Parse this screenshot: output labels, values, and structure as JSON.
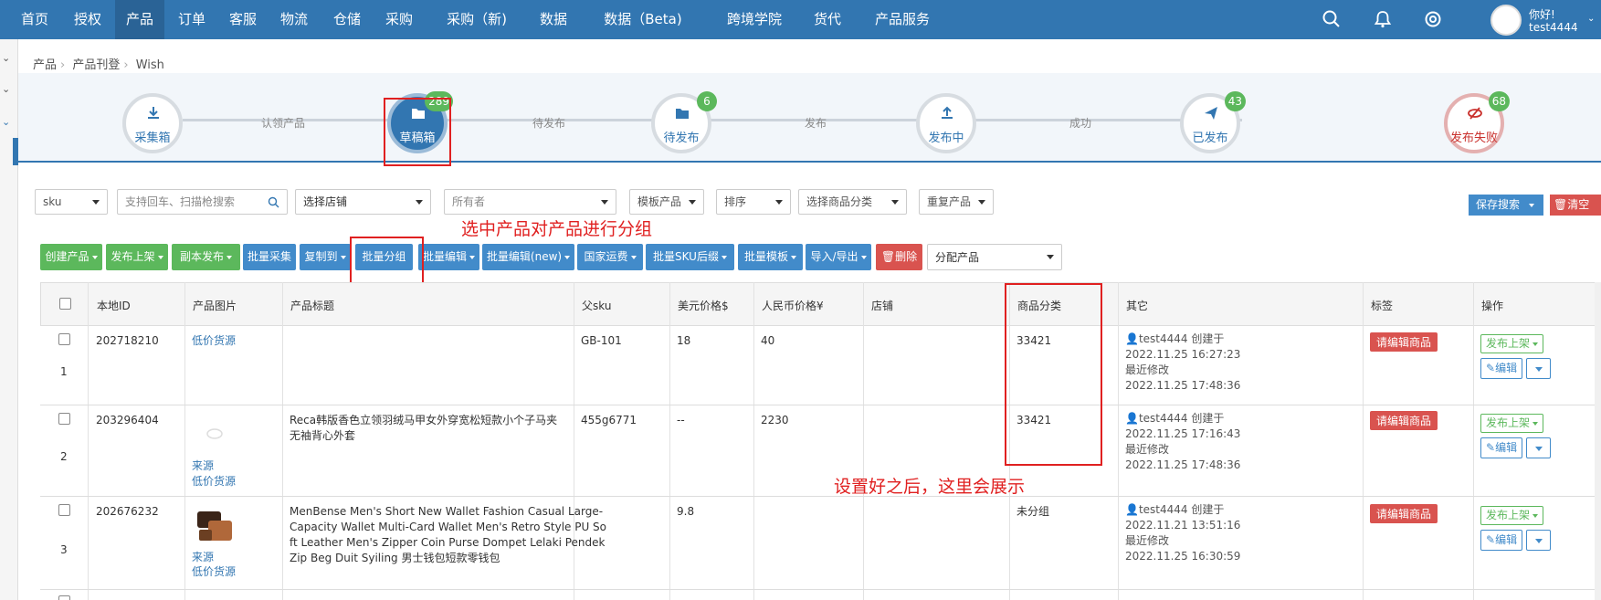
{
  "nav": {
    "items": [
      "首页",
      "授权",
      "产品",
      "订单",
      "客服",
      "物流",
      "仓储",
      "采购",
      "采购（新)",
      "数据",
      "数据（Beta)",
      "跨境学院",
      "货代",
      "产品服务"
    ],
    "active": "产品",
    "user_greeting": "你好!",
    "user_name": "test4444"
  },
  "breadcrumb": [
    "产品",
    "产品刊登",
    "Wish"
  ],
  "steps": [
    {
      "label": "采集箱",
      "badge": ""
    },
    {
      "label": "草稿箱",
      "badge": "289"
    },
    {
      "label": "待发布",
      "badge": "6"
    },
    {
      "label": "发布中",
      "badge": ""
    },
    {
      "label": "已发布",
      "badge": "43"
    },
    {
      "label": "发布失败",
      "badge": "68"
    }
  ],
  "step_links": [
    "认领产品",
    "待发布",
    "发布",
    "成功"
  ],
  "filters": {
    "sku": "sku",
    "search_placeholder": "支持回车、扫描枪搜索",
    "shop": "选择店铺",
    "owner": "所有者",
    "template": "模板产品",
    "sort": "排序",
    "category": "选择商品分类",
    "duplicate": "重复产品",
    "save_search": "保存搜索",
    "clear": "清空"
  },
  "annotations": {
    "group_hint": "选中产品对产品进行分组",
    "show_hint": "设置好之后，这里会展示"
  },
  "toolbar": {
    "create": "创建产品",
    "publish": "发布上架",
    "copy_publish": "副本发布",
    "batch_collect": "批量采集",
    "copy_to": "复制到",
    "batch_group": "批量分组",
    "batch_edit": "批量编辑",
    "batch_edit_new": "批量编辑(new)",
    "shipping": "国家运费",
    "sku_suffix": "批量SKU后缀",
    "batch_template": "批量模板",
    "import_export": "导入/导出",
    "delete": "删除",
    "assign": "分配产品"
  },
  "table": {
    "headers": [
      "本地ID",
      "产品图片",
      "产品标题",
      "父sku",
      "美元价格$",
      "人民币价格¥",
      "店铺",
      "商品分类",
      "其它",
      "标签",
      "操作"
    ],
    "rows": [
      {
        "num": "1",
        "id": "202718210",
        "img_links": [
          "低价货源"
        ],
        "title": "",
        "parent_sku": "GB-101",
        "usd": "18",
        "cny": "40",
        "shop": "",
        "category": "33421",
        "creator": "test4444 创建于",
        "created": "2022.11.25 16:27:23",
        "modified_label": "最近修改",
        "modified": "2022.11.25 17:48:36",
        "tag": "请编辑商品",
        "publish": "发布上架",
        "edit": "编辑"
      },
      {
        "num": "2",
        "id": "203296404",
        "img_links": [
          "来源",
          "低价货源"
        ],
        "title": "Reca韩版香色立领羽绒马甲女外穿宽松短款小个子马夹无袖背心外套",
        "parent_sku": "455g6771",
        "usd": "--",
        "cny": "2230",
        "shop": "",
        "category": "33421",
        "creator": "test4444 创建于",
        "created": "2022.11.25 17:16:43",
        "modified_label": "最近修改",
        "modified": "2022.11.25 17:48:36",
        "tag": "请编辑商品",
        "publish": "发布上架",
        "edit": "编辑"
      },
      {
        "num": "3",
        "id": "202676232",
        "img_links": [
          "来源",
          "低价货源"
        ],
        "title": "MenBense Men's Short New Wallet Fashion Casual Large-Capacity Wallet Multi-Card Wallet Men's Retro Style PU Soft Leather Men's Zipper Coin Purse Dompet Lelaki Pendek Zip Beg Duit Syiling 男士钱包短款零钱包",
        "parent_sku": "",
        "usd": "9.8",
        "cny": "",
        "shop": "",
        "category": "未分组",
        "creator": "test4444 创建于",
        "created": "2022.11.21 13:51:16",
        "modified_label": "最近修改",
        "modified": "2022.11.25 16:30:59",
        "tag": "请编辑商品",
        "publish": "发布上架",
        "edit": "编辑"
      }
    ]
  },
  "colors": {
    "nav": "#3276b1",
    "green": "#5cb85c",
    "blue": "#428bca",
    "red": "#d9534f",
    "annotation": "#e02020"
  }
}
